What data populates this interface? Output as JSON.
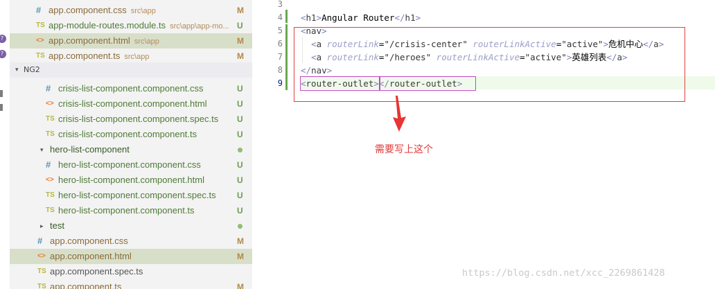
{
  "sidebar": {
    "top_items": [
      {
        "icon": "#",
        "icon_type": "css",
        "name": "app.component.css",
        "path": "src\\app",
        "status": "M"
      },
      {
        "icon": "TS",
        "icon_type": "ts",
        "name": "app-module-routes.module.ts",
        "path": "src\\app\\app-mo...",
        "status": "U"
      },
      {
        "icon": "<>",
        "icon_type": "html",
        "name": "app.component.html",
        "path": "src\\app",
        "status": "M",
        "selected": true
      },
      {
        "icon": "TS",
        "icon_type": "ts",
        "name": "app.component.ts",
        "path": "src\\app",
        "status": "M"
      }
    ],
    "section_title": "NG2",
    "tree_items": [
      {
        "icon": "#",
        "icon_type": "css",
        "name": "crisis-list-component.component.css",
        "status": "U"
      },
      {
        "icon": "<>",
        "icon_type": "html",
        "name": "crisis-list-component.component.html",
        "status": "U"
      },
      {
        "icon": "TS",
        "icon_type": "ts",
        "name": "crisis-list-component.component.spec.ts",
        "status": "U"
      },
      {
        "icon": "TS",
        "icon_type": "ts",
        "name": "crisis-list-component.component.ts",
        "status": "U"
      },
      {
        "folder": true,
        "name": "hero-list-component",
        "expanded": true
      },
      {
        "icon": "#",
        "icon_type": "css",
        "name": "hero-list-component.component.css",
        "status": "U"
      },
      {
        "icon": "<>",
        "icon_type": "html",
        "name": "hero-list-component.component.html",
        "status": "U"
      },
      {
        "icon": "TS",
        "icon_type": "ts",
        "name": "hero-list-component.component.spec.ts",
        "status": "U"
      },
      {
        "icon": "TS",
        "icon_type": "ts",
        "name": "hero-list-component.component.ts",
        "status": "U"
      },
      {
        "folder": true,
        "name": "test",
        "expanded": false
      },
      {
        "icon": "#",
        "icon_type": "css",
        "name": "app.component.css",
        "status": "M"
      },
      {
        "icon": "<>",
        "icon_type": "html",
        "name": "app.component.html",
        "status": "M",
        "selected": true
      },
      {
        "icon": "TS",
        "icon_type": "ts",
        "name": "app.component.spec.ts",
        "status": ""
      },
      {
        "icon": "TS",
        "icon_type": "ts",
        "name": "app.component.ts",
        "status": "M"
      }
    ]
  },
  "editor": {
    "line_numbers": [
      "3",
      "4",
      "5",
      "6",
      "7",
      "8",
      "9"
    ],
    "lines": [
      "",
      "<h1>Angular Router</h1>",
      "<nav>",
      "  <a routerLink=\"/crisis-center\" routerLinkActive=\"active\">危机中心</a>",
      "  <a routerLink=\"/heroes\" routerLinkActive=\"active\">英雄列表</a>",
      "</nav>",
      "<router-outlet></router-outlet>"
    ]
  },
  "annotation": {
    "note": "需要写上这个",
    "color": "#e23a3a"
  },
  "watermark": "https://blog.csdn.net/xcc_2269861428"
}
